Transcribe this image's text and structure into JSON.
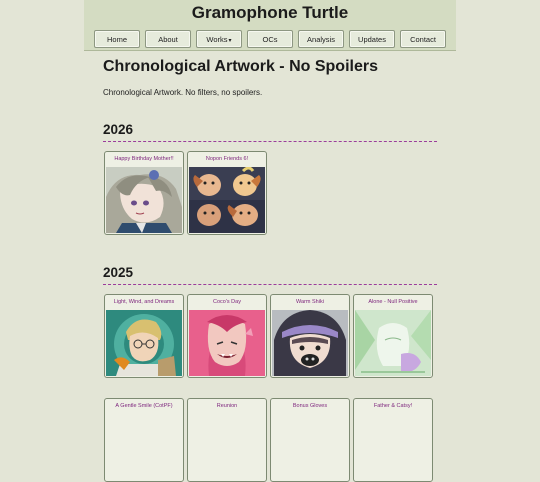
{
  "site": {
    "title": "Gramophone Turtle"
  },
  "nav": [
    {
      "label": "Home"
    },
    {
      "label": "About"
    },
    {
      "label": "Works",
      "caret": "▾"
    },
    {
      "label": "OCs"
    },
    {
      "label": "Analysis"
    },
    {
      "label": "Updates"
    },
    {
      "label": "Contact"
    }
  ],
  "main": {
    "title": "Chronological Artwork - No Spoilers",
    "intro": "Chronological Artwork. No filters, no spoilers."
  },
  "sections": [
    {
      "year": "2026",
      "items": [
        {
          "title": "Happy Birthday Mother!!",
          "thumb_icon": "grey-haired-character-portrait"
        },
        {
          "title": "Nopon Friends 6!",
          "thumb_icon": "nopon-group-illustration"
        }
      ]
    },
    {
      "year": "2025",
      "items": [
        {
          "title": "Light, Wind, and Dreams",
          "thumb_icon": "blond-glasses-character-portrait"
        },
        {
          "title": "Coco's Day",
          "thumb_icon": "pink-haired-character-portrait"
        },
        {
          "title": "Warm Shiki",
          "thumb_icon": "hooded-character-portrait"
        },
        {
          "title": "Alone - Null Positive",
          "thumb_icon": "pale-green-sketch"
        },
        {
          "title": "A Gentle Smile (CotPF)"
        },
        {
          "title": "Reunion"
        },
        {
          "title": "Bonus Gloves"
        },
        {
          "title": "Father & Catsy!"
        }
      ]
    }
  ],
  "colors": {
    "background": "#e3e5d6",
    "header": "#d4dcc2",
    "card_title": "#7a1f7a",
    "rule": "#9b3c9b"
  }
}
